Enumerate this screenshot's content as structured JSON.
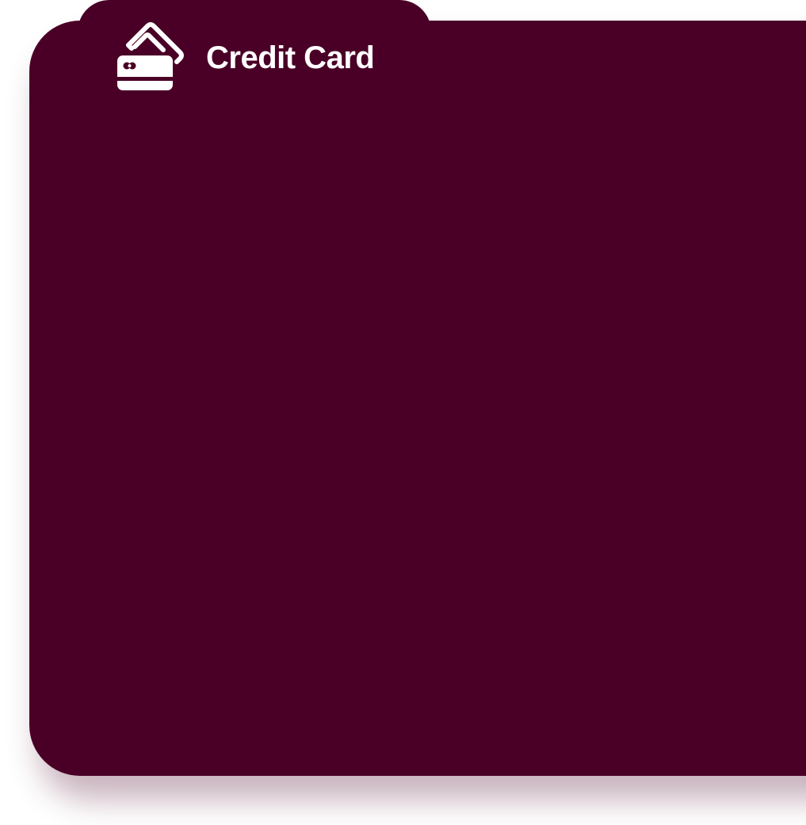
{
  "card": {
    "title": "Credit Card",
    "icon": "credit-card-icon",
    "background_color": "#4a0026",
    "text_color": "#ffffff"
  }
}
